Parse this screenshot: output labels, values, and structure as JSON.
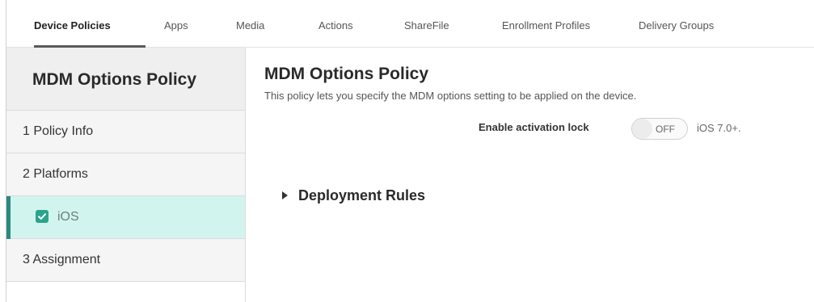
{
  "nav": {
    "tabs": [
      {
        "label": "Device Policies",
        "active": true
      },
      {
        "label": "Apps"
      },
      {
        "label": "Media"
      },
      {
        "label": "Actions"
      },
      {
        "label": "ShareFile"
      },
      {
        "label": "Enrollment Profiles"
      },
      {
        "label": "Delivery Groups"
      }
    ]
  },
  "sidebar": {
    "title": "MDM Options Policy",
    "items": [
      {
        "label": "1  Policy Info"
      },
      {
        "label": "2  Platforms"
      },
      {
        "label": "iOS",
        "checked": true,
        "selected": true
      },
      {
        "label": "3  Assignment"
      }
    ]
  },
  "main": {
    "title": "MDM Options Policy",
    "description": "This policy lets you specify the MDM options setting to be applied on the device.",
    "activation_lock": {
      "label": "Enable activation lock",
      "state": "OFF",
      "version_note": "iOS 7.0+."
    },
    "deployment_rules": "Deployment Rules"
  },
  "colors": {
    "selected_bg": "#d2f4ee",
    "accent": "#2aa48c",
    "marker": "#2a8a7e"
  }
}
